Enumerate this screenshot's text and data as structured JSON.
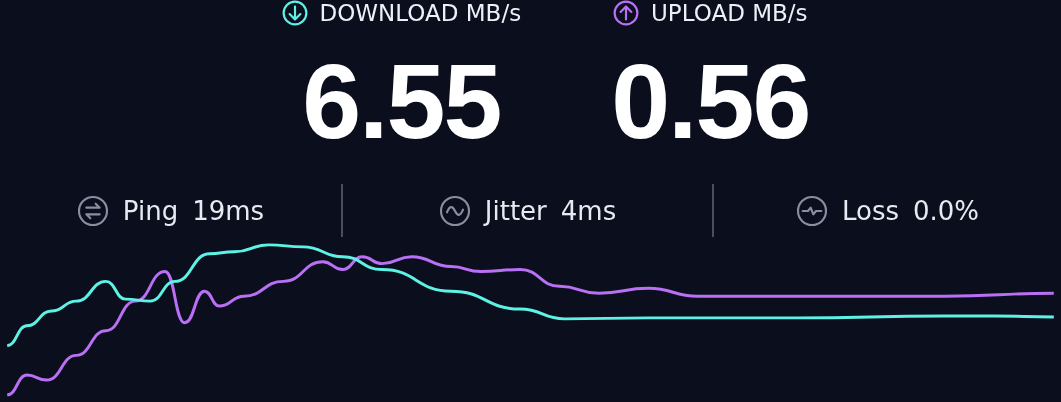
{
  "metrics": [
    {
      "kind": "download",
      "label": "DOWNLOAD MB/s",
      "value": "6.55"
    },
    {
      "kind": "upload",
      "label": "UPLOAD MB/s",
      "value": "0.56"
    }
  ],
  "stats": [
    {
      "kind": "ping",
      "label": "Ping",
      "value": "19ms"
    },
    {
      "kind": "jitter",
      "label": "Jitter",
      "value": "4ms"
    },
    {
      "kind": "loss",
      "label": "Loss",
      "value": "0.0%"
    }
  ]
}
